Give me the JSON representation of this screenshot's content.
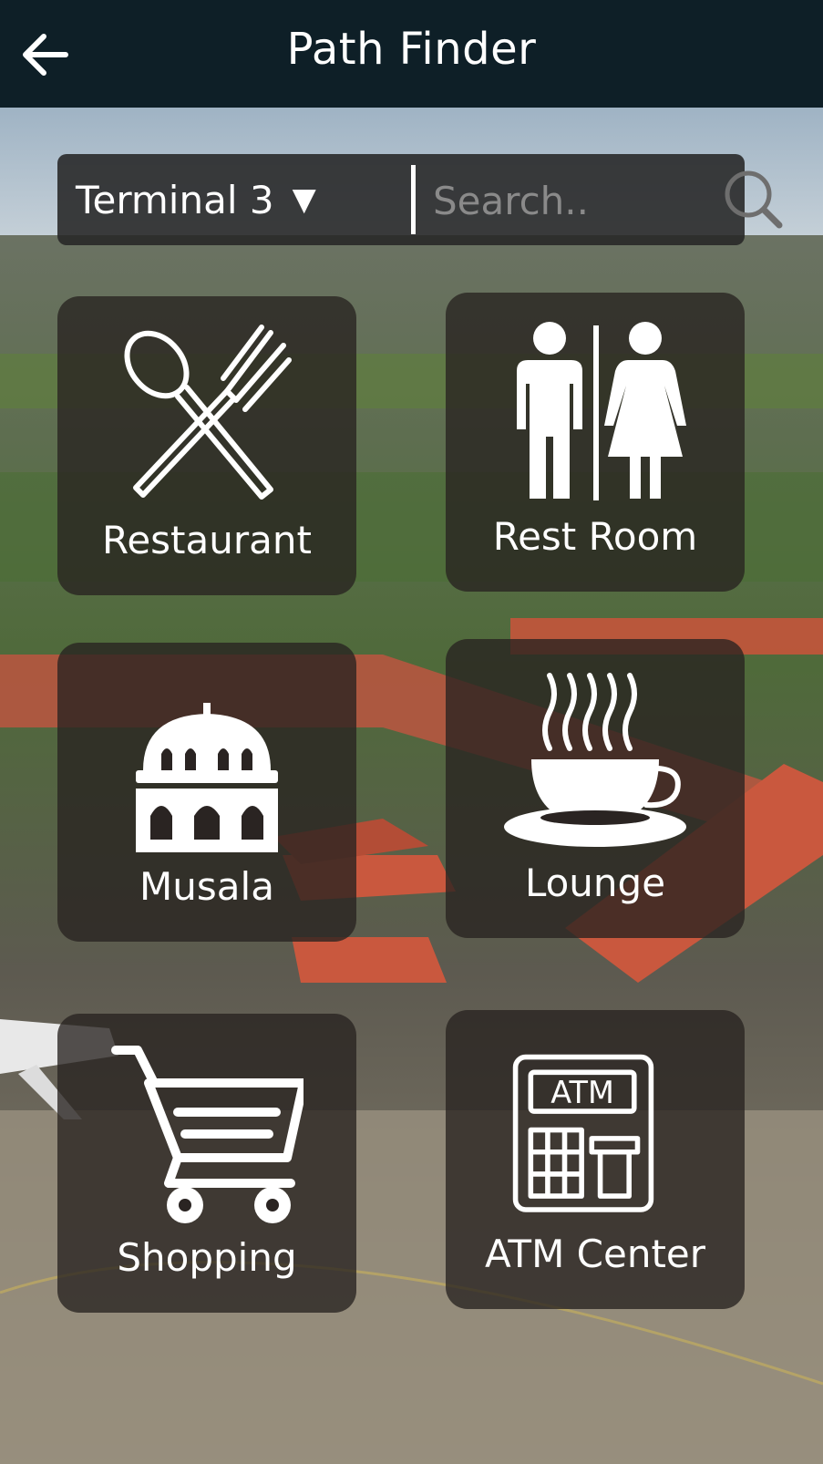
{
  "header": {
    "title": "Path Finder",
    "back_icon": "arrow-left-icon"
  },
  "search": {
    "terminal": "Terminal 3",
    "terminal_arrow": "▼",
    "placeholder": "Search..",
    "icon": "search-icon"
  },
  "categories": [
    {
      "label": "Restaurant",
      "icon": "fork-spoon-icon"
    },
    {
      "label": "Rest Room",
      "icon": "restroom-icon"
    },
    {
      "label": "Musala",
      "icon": "mosque-icon"
    },
    {
      "label": "Lounge",
      "icon": "coffee-cup-icon"
    },
    {
      "label": "Shopping",
      "icon": "shopping-cart-icon"
    },
    {
      "label": "ATM Center",
      "icon": "atm-icon"
    }
  ],
  "atm_sign": "ATM",
  "colors": {
    "header_bg": "#0e1f27",
    "tile_bg": "rgba(40,34,32,0.78)",
    "roof": "#c4553b"
  }
}
